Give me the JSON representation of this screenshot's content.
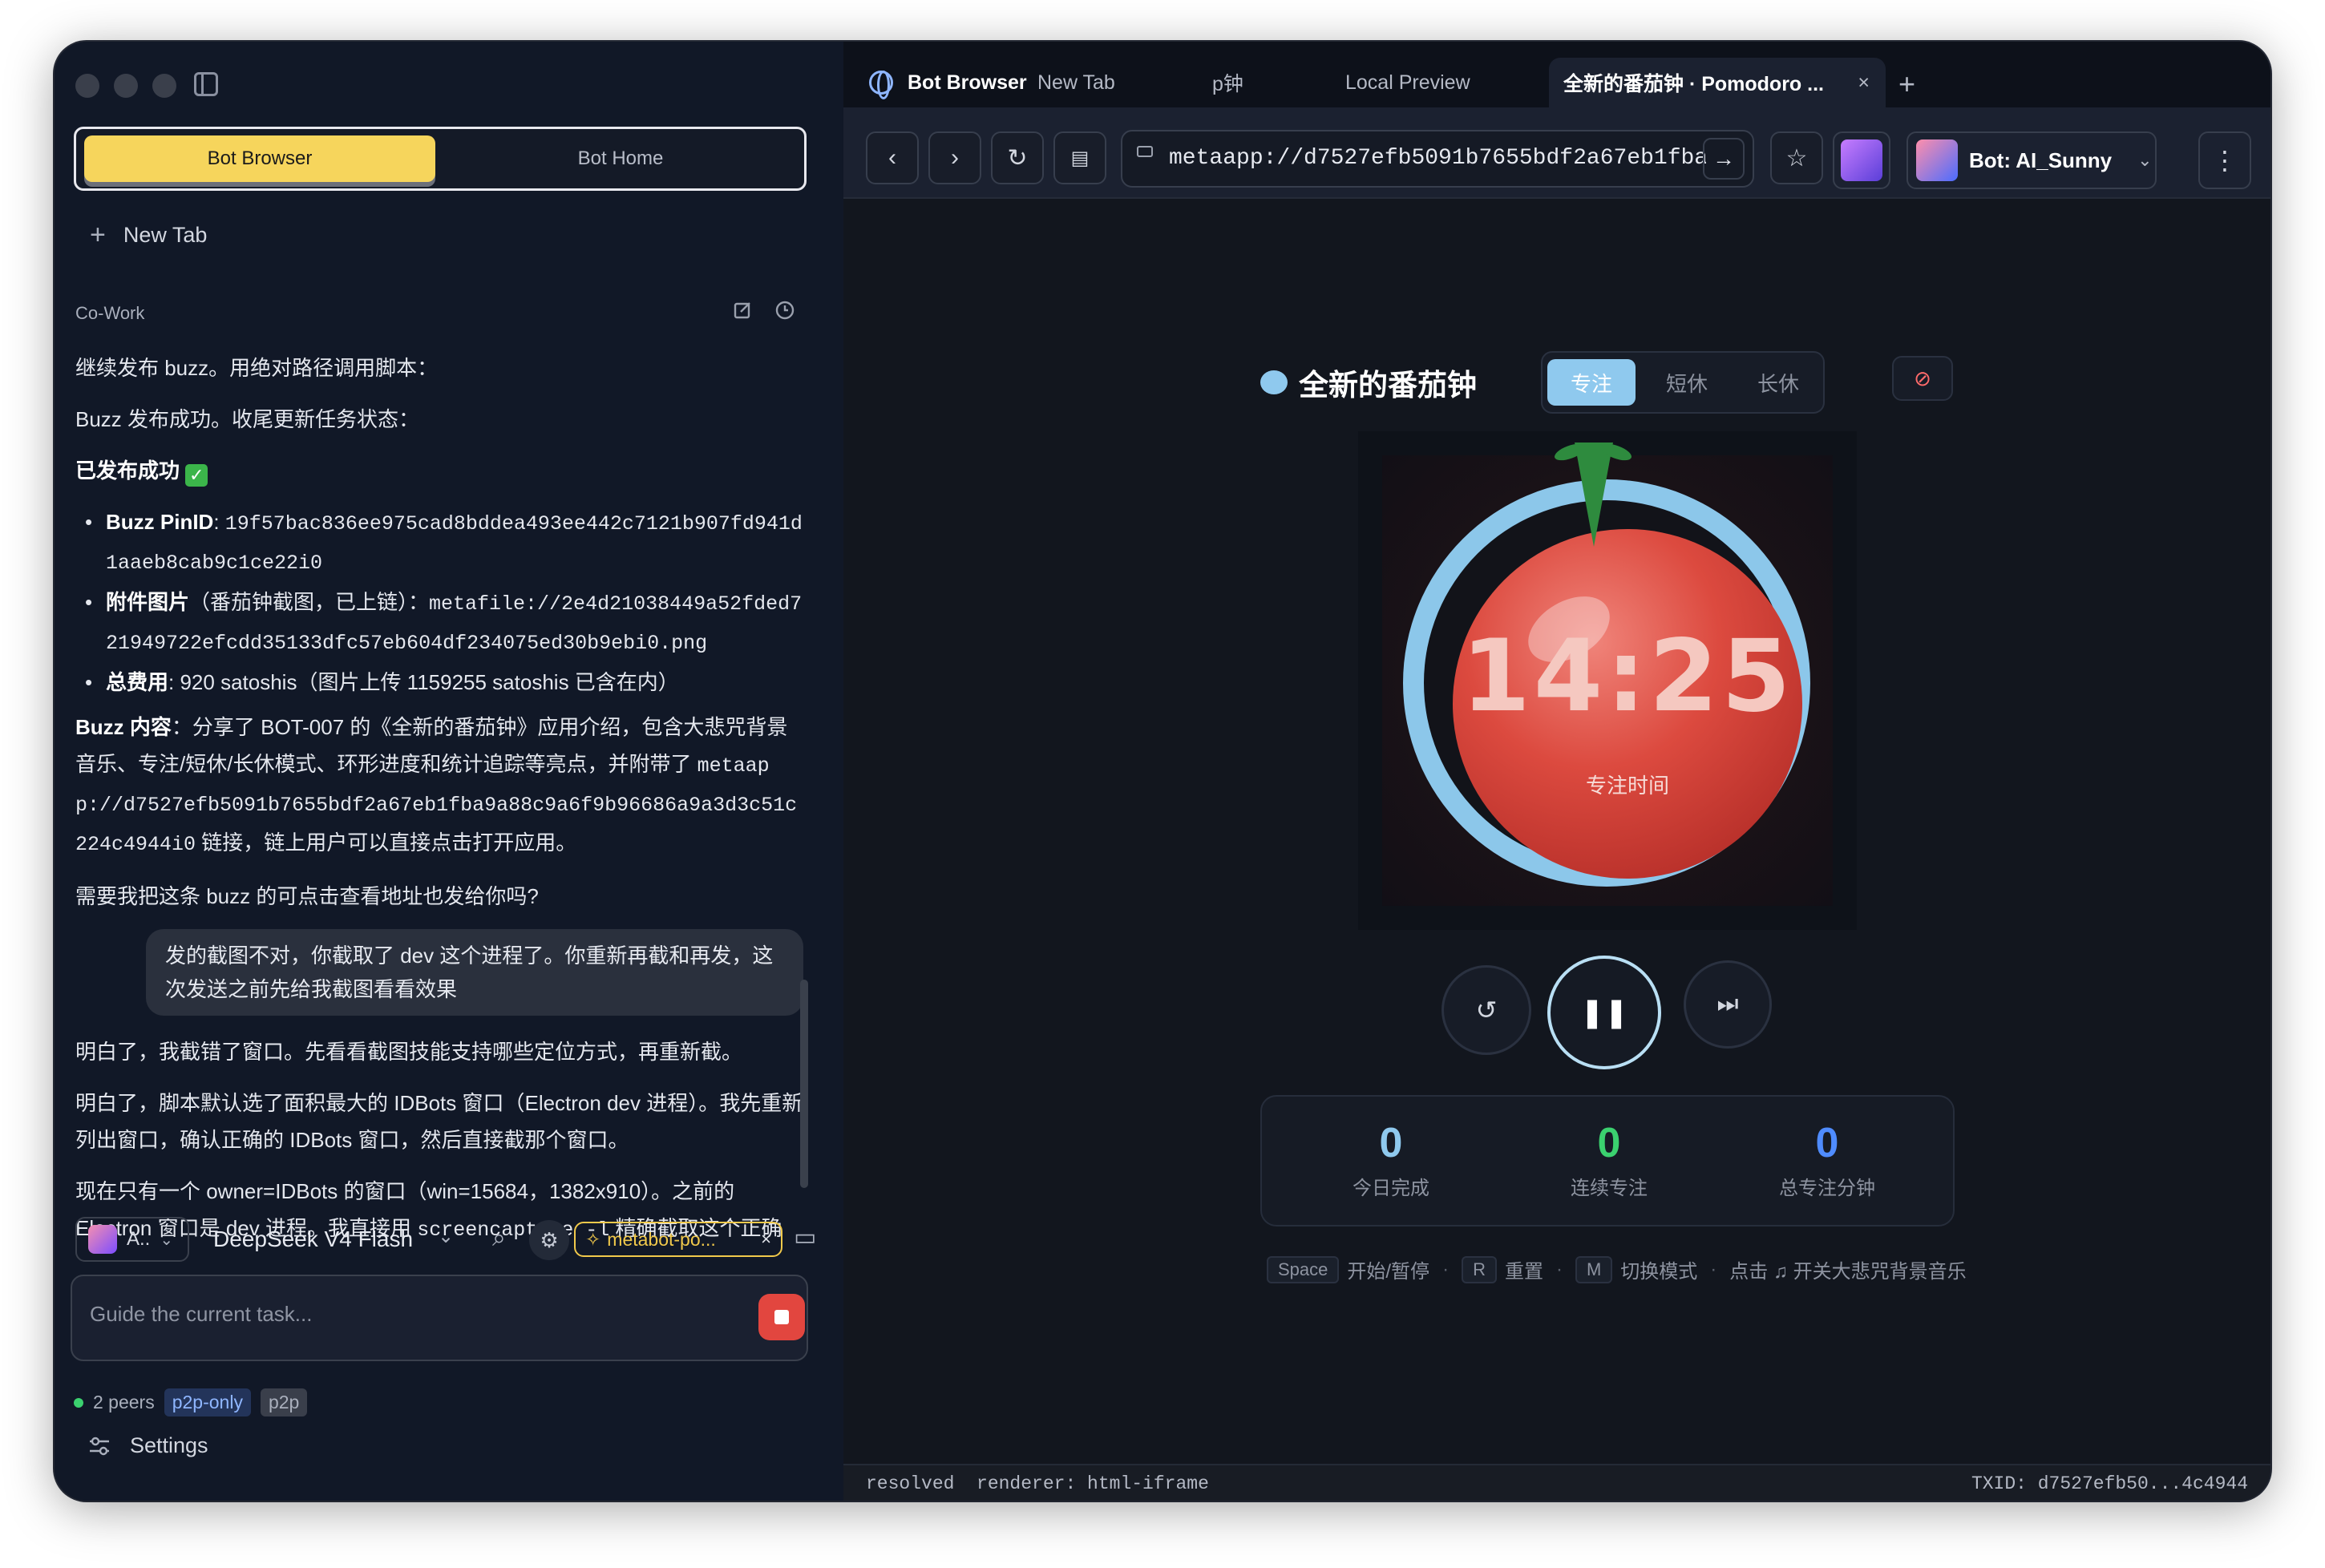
{
  "sidebar": {
    "segment": {
      "active": "Bot Browser",
      "inactive": "Bot Home"
    },
    "new_tab": "New Tab",
    "section_title": "Co-Work",
    "messages": {
      "m1": "继续发布 buzz。用绝对路径调用脚本：",
      "m2": "Buzz 发布成功。收尾更新任务状态：",
      "m3_title": "已发布成功",
      "m3_check": "✓",
      "bullet1_label": "Buzz PinID",
      "bullet1_sep": ": ",
      "bullet1_value": "19f57bac836ee975cad8bddea493ee442c7121b907fd941d1aaeb8cab9c1ce22i0",
      "bullet2_label": "附件图片",
      "bullet2_note": "（番茄钟截图，已上链）：",
      "bullet2_value": "metafile://2e4d21038449a52fded721949722efcdd35133dfc57eb604df234075ed30b9ebi0.png",
      "bullet3_label": "总费用",
      "bullet3_value": ": 920 satoshis（图片上传 1159255 satoshis 已含在内）",
      "content_label": "Buzz 内容",
      "content_text": "：分享了 BOT-007 的《全新的番茄钟》应用介绍，包含大悲咒背景音乐、专注/短休/长休模式、环形进度和统计追踪等亮点，并附带了 ",
      "content_link": "metaapp://d7527efb5091b7655bdf2a67eb1fba9a88c9a6f9b96686a9a3d3c51c224c4944i0",
      "content_tail": " 链接，链上用户可以直接点击打开应用。",
      "question": "需要我把这条 buzz 的可点击查看地址也发给你吗?",
      "user": "发的截图不对，你截取了 dev 这个进程了。你重新再截和再发，这次发送之前先给我截图看看效果",
      "r1": "明白了，我截错了窗口。先看看截图技能支持哪些定位方式，再重新截。",
      "r2": "明白了，脚本默认选了面积最大的 IDBots 窗口（Electron dev 进程）。我先重新列出窗口，确认正确的 IDBots 窗口，然后直接截那个窗口。",
      "r3a": "现在只有一个 owner=IDBots 的窗口（win=15684，1382x910）。之前的 Electron 窗口是 dev 进程。我直接用 ",
      "r3b": "screencapture -l",
      "r3c": " 精确截取这个正确"
    },
    "composer": {
      "agent": "A..",
      "model": "DeepSeek V4 Flash",
      "skill": "metabot-po...",
      "skill_close": "×",
      "placeholder": "Guide the current task..."
    },
    "peers": {
      "text": "2 peers",
      "tag1": "p2p-only",
      "tag2": "p2p"
    },
    "settings": "Settings"
  },
  "browser": {
    "brand": "Bot Browser",
    "tabs": [
      "New Tab",
      "p钟",
      "Local Preview"
    ],
    "active_tab": "全新的番茄钟 · Pomodoro ...",
    "active_tab_close": "×",
    "url": "metaapp://d7527efb5091b7655bdf2a67eb1fba",
    "bot": "Bot: AI_Sunny",
    "more": "⋮"
  },
  "app": {
    "title": "全新的番茄钟",
    "modes": [
      "专注",
      "短休",
      "长休"
    ],
    "time": "14:25",
    "time_label": "专注时间",
    "stats": [
      {
        "value": "0",
        "label": "今日完成"
      },
      {
        "value": "0",
        "label": "连续专注"
      },
      {
        "value": "0",
        "label": "总专注分钟"
      }
    ],
    "hints": {
      "k1": "Space",
      "t1": "开始/暂停",
      "k2": "R",
      "t2": "重置",
      "k3": "M",
      "t3": "切换模式",
      "t4": "点击 ♫ 开关大悲咒背景音乐",
      "dot": "·"
    }
  },
  "statusbar": {
    "left": "resolved  renderer: html-iframe",
    "right": "TXID: d7527efb50...4c4944"
  },
  "colors": {
    "accent_yellow": "#f6d55c",
    "accent_blue": "#8fc9ee",
    "stop_red": "#e2463f",
    "stat_green": "#3bd16f",
    "stat_blue": "#4f8cff"
  }
}
